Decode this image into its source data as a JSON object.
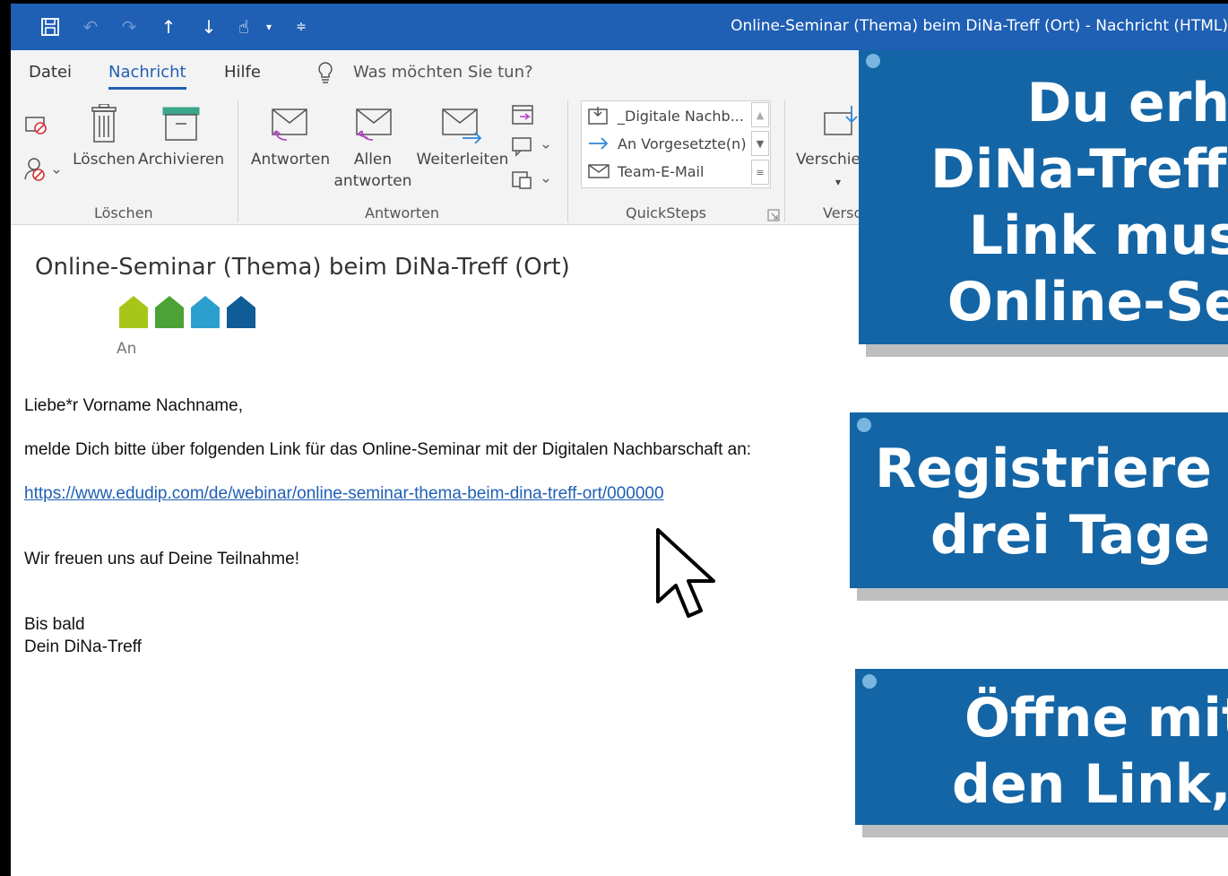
{
  "titlebar": {
    "title": "Online-Seminar (Thema) beim DiNa-Treff (Ort)  -  Nachricht (HTML)"
  },
  "tabs": {
    "datei": "Datei",
    "nachricht": "Nachricht",
    "hilfe": "Hilfe",
    "search_placeholder": "Was möchten Sie tun?"
  },
  "ribbon": {
    "loeschen": "Löschen",
    "archivieren": "Archivieren",
    "antworten": "Antworten",
    "allen": "Allen",
    "antworten2": "antworten",
    "weiterleiten": "Weiterleiten",
    "verschieben": "Verschie",
    "group_loeschen": "Löschen",
    "group_antworten": "Antworten",
    "group_quicksteps": "QuickSteps",
    "group_verschieben": "Versc",
    "quicksteps": [
      "_Digitale Nachb...",
      "An Vorgesetzte(n)",
      "Team-E-Mail"
    ]
  },
  "mail": {
    "subject": "Online-Seminar (Thema) beim DiNa-Treff (Ort)",
    "to_label": "An",
    "greeting": "Liebe*r Vorname Nachname,",
    "line1": "melde Dich bitte über folgenden Link für das Online-Seminar mit der Digitalen Nachbarschaft an:",
    "link": "https://www.edudip.com/de/webinar/online-seminar-thema-beim-dina-treff-ort/000000",
    "closing": "Wir freuen uns auf Deine Teilnahme!",
    "sign1": "Bis bald",
    "sign2": "Dein DiNa-Treff"
  },
  "overlays": {
    "box1": [
      "Du erh",
      "DiNa-Treff e",
      "Link mus",
      "Online-Se"
    ],
    "box2": [
      "Registriere Di",
      "drei Tage vo"
    ],
    "box3": [
      "Öffne mit",
      "den Link, u"
    ]
  },
  "colors": {
    "titlebar": "#1f5fb4",
    "overlay": "#1465a5",
    "house1": "#a8c619",
    "house2": "#4ca236",
    "house3": "#2ba0cf",
    "house4": "#0f5c96"
  }
}
